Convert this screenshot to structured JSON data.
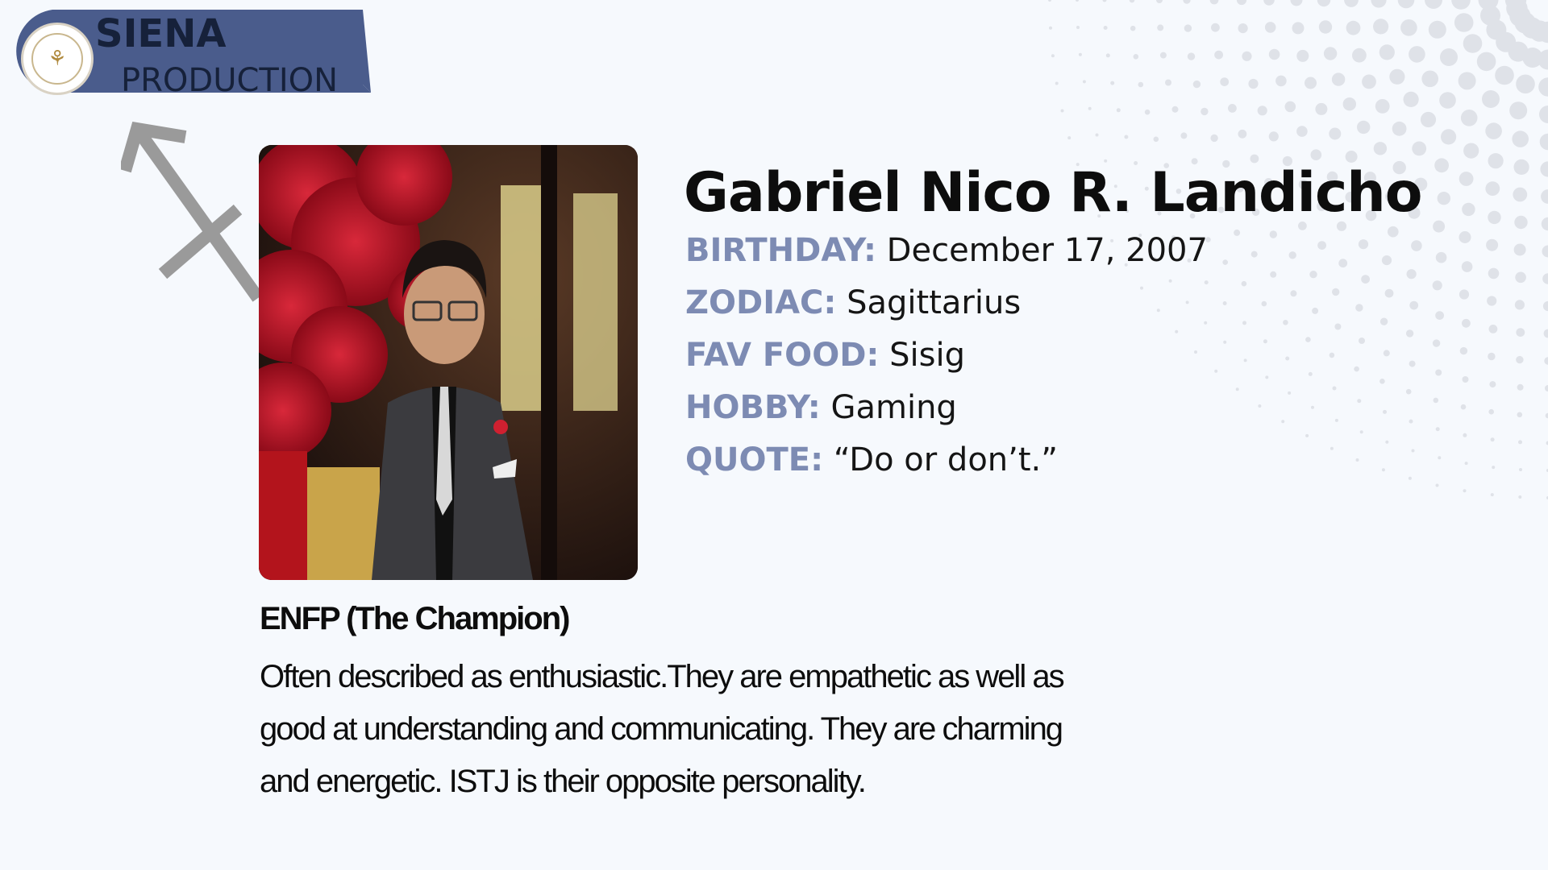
{
  "brand": {
    "line1": "SIENA",
    "line2": "PRODUCTION",
    "seal_icon": "school-seal-icon",
    "banner_color": "#4a5c8c"
  },
  "zodiac_icon": "sagittarius-symbol-icon",
  "profile": {
    "name": "Gabriel Nico R. Landicho",
    "facts": [
      {
        "label": "BIRTHDAY:",
        "value": "December 17, 2007"
      },
      {
        "label": "ZODIAC:",
        "value": "Sagittarius"
      },
      {
        "label": "FAV FOOD:",
        "value": "Sisig"
      },
      {
        "label": "HOBBY:",
        "value": "Gaming"
      },
      {
        "label": "QUOTE:",
        "value": "“Do or don’t.”"
      }
    ],
    "label_color": "#7d8bb3"
  },
  "personality": {
    "type": "ENFP (The Champion)",
    "description": "Often described as enthusiastic.They are empathetic as well as good at understanding and communicating. They are charming and energetic. ISTJ is their opposite personality."
  }
}
